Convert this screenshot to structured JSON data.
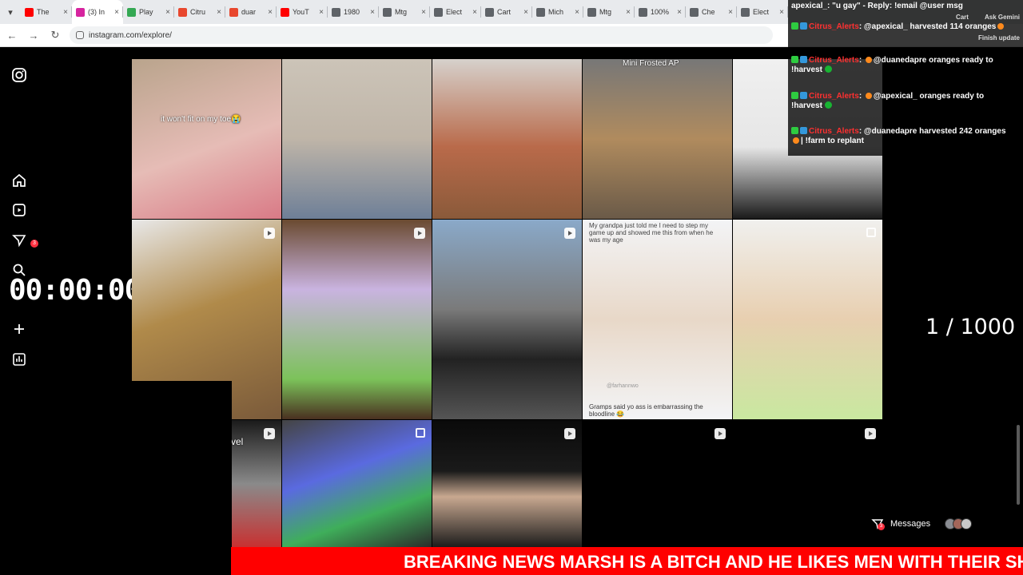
{
  "tabs": [
    {
      "label": "The",
      "color": "#ff0000"
    },
    {
      "label": "(3) In",
      "color": "#d6249f",
      "active": true
    },
    {
      "label": "Play",
      "color": "#34a853"
    },
    {
      "label": "Citru",
      "color": "#e8472e"
    },
    {
      "label": "duar",
      "color": "#e8472e"
    },
    {
      "label": "YouT",
      "color": "#ff0000"
    },
    {
      "label": "1980",
      "color": "#5f6368"
    },
    {
      "label": "Mtg",
      "color": "#5f6368"
    },
    {
      "label": "Elect",
      "color": "#5f6368"
    },
    {
      "label": "Cart",
      "color": "#5f6368"
    },
    {
      "label": "Mich",
      "color": "#5f6368"
    },
    {
      "label": "Mtg",
      "color": "#5f6368"
    },
    {
      "label": "100%",
      "color": "#5f6368"
    },
    {
      "label": "Che",
      "color": "#5f6368"
    },
    {
      "label": "Elect",
      "color": "#5f6368"
    }
  ],
  "address": {
    "url": "instagram.com/explore/"
  },
  "sidebar": {
    "notification_count": "3"
  },
  "timer": "00:00:00",
  "counter": "1 / 1000",
  "tiles": [
    {
      "caption": "it won't fit on my toe😭",
      "kind": "none"
    },
    {
      "caption": "",
      "kind": "none"
    },
    {
      "caption": "",
      "kind": "none"
    },
    {
      "caption": "Mini Frosted AP",
      "kind": "none"
    },
    {
      "caption": "",
      "kind": "none"
    },
    {
      "caption": "",
      "kind": "reel"
    },
    {
      "caption": "",
      "kind": "reel"
    },
    {
      "caption": "",
      "kind": "reel"
    },
    {
      "caption": "My grandpa just told me I need to step my game up and showed me this from when he was my age",
      "caption2": "Gramps said yo ass is embarrassing the bloodline 😂",
      "handle": "@farhannwo",
      "kind": "none"
    },
    {
      "caption": "",
      "kind": "multi"
    },
    {
      "caption": "vel",
      "kind": "reel"
    },
    {
      "caption": "",
      "kind": "multi"
    },
    {
      "caption": "",
      "kind": "reel"
    },
    {
      "caption": "",
      "kind": "reel"
    },
    {
      "caption": "",
      "kind": "reel"
    }
  ],
  "chat": {
    "top_line": "apexical_: \"u gay\" - Reply: !email @user msg",
    "lines": [
      {
        "user": "Citrus_Alerts",
        "text": "@apexical_ harvested 114 oranges"
      },
      {
        "user": "Citrus_Alerts",
        "text": "@duanedapre oranges ready to",
        "text2": "!harvest"
      },
      {
        "user": "Citrus_Alerts",
        "text": "@apexical_ oranges ready to",
        "text2": "!harvest"
      },
      {
        "user": "Citrus_Alerts",
        "text": "@duanedapre harvested 242 oranges",
        "text2": "| !farm to replant"
      }
    ],
    "ask_gemini": "Ask Gemini",
    "finish_update": "Finish update",
    "cart_label": "Cart"
  },
  "messages": {
    "label": "Messages",
    "badge": "3"
  },
  "ticker": {
    "text": "BREAKING NEWS MARSH IS A BITCH AND HE LIKES MEN WITH THEIR SH"
  },
  "colors": {
    "brand": "#d6249f",
    "ticker_bg": "#ff0000",
    "alert_user": "#ff3030"
  }
}
